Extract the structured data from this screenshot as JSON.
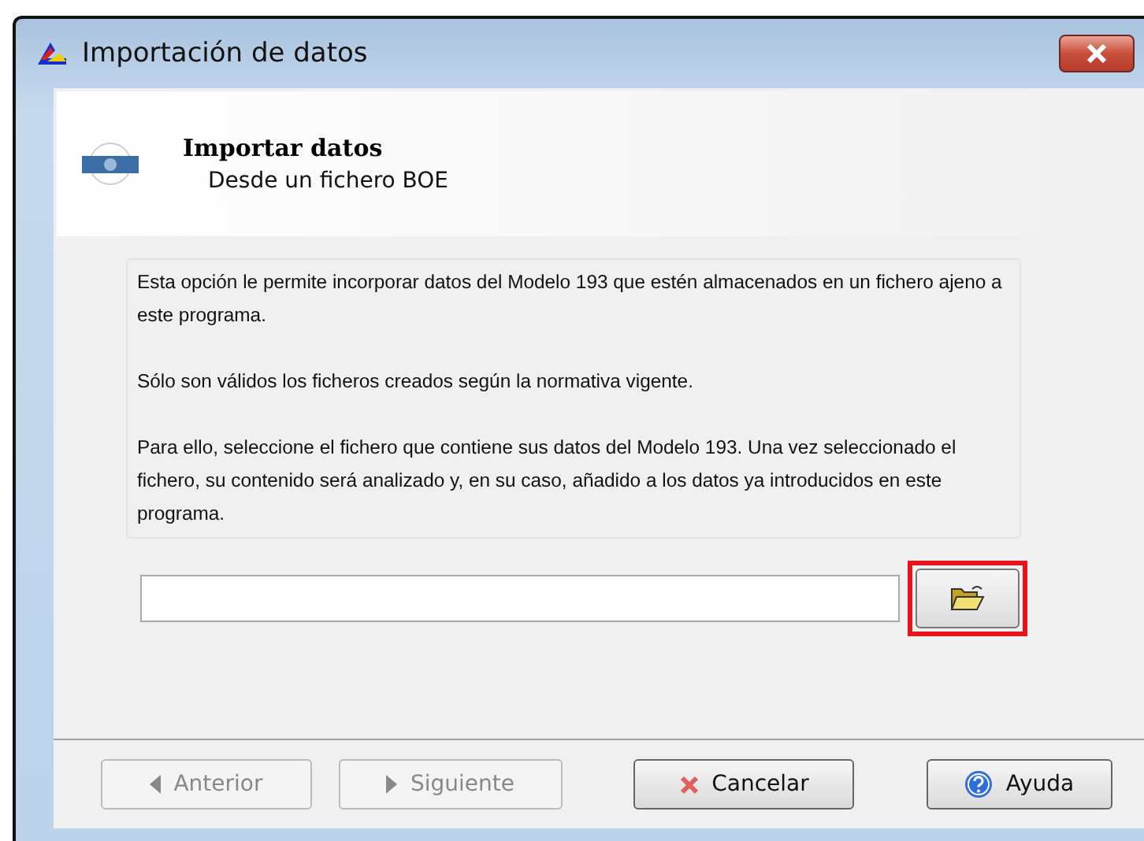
{
  "window": {
    "title": "Importación de datos"
  },
  "header": {
    "title": "Importar datos",
    "subtitle": "Desde un fichero BOE"
  },
  "description": [
    "Esta opción le permite incorporar datos del Modelo 193 que estén almacenados en un fichero ajeno a este programa.",
    "Sólo son válidos los ficheros creados según la normativa vigente.",
    "Para ello, seleccione el fichero que contiene sus datos del Modelo 193. Una vez seleccionado el fichero, su contenido será analizado y, en su caso, añadido a los datos ya introducidos en este programa."
  ],
  "browse_button": {
    "highlighted": true
  },
  "buttons": [
    {
      "kind": "back",
      "label": "Anterior",
      "disabled": true
    },
    {
      "kind": "next",
      "label": "Siguiente",
      "disabled": true
    },
    {
      "kind": "cancel",
      "label": "Cancelar",
      "disabled": false
    },
    {
      "kind": "help",
      "label": "Ayuda",
      "disabled": false
    }
  ]
}
